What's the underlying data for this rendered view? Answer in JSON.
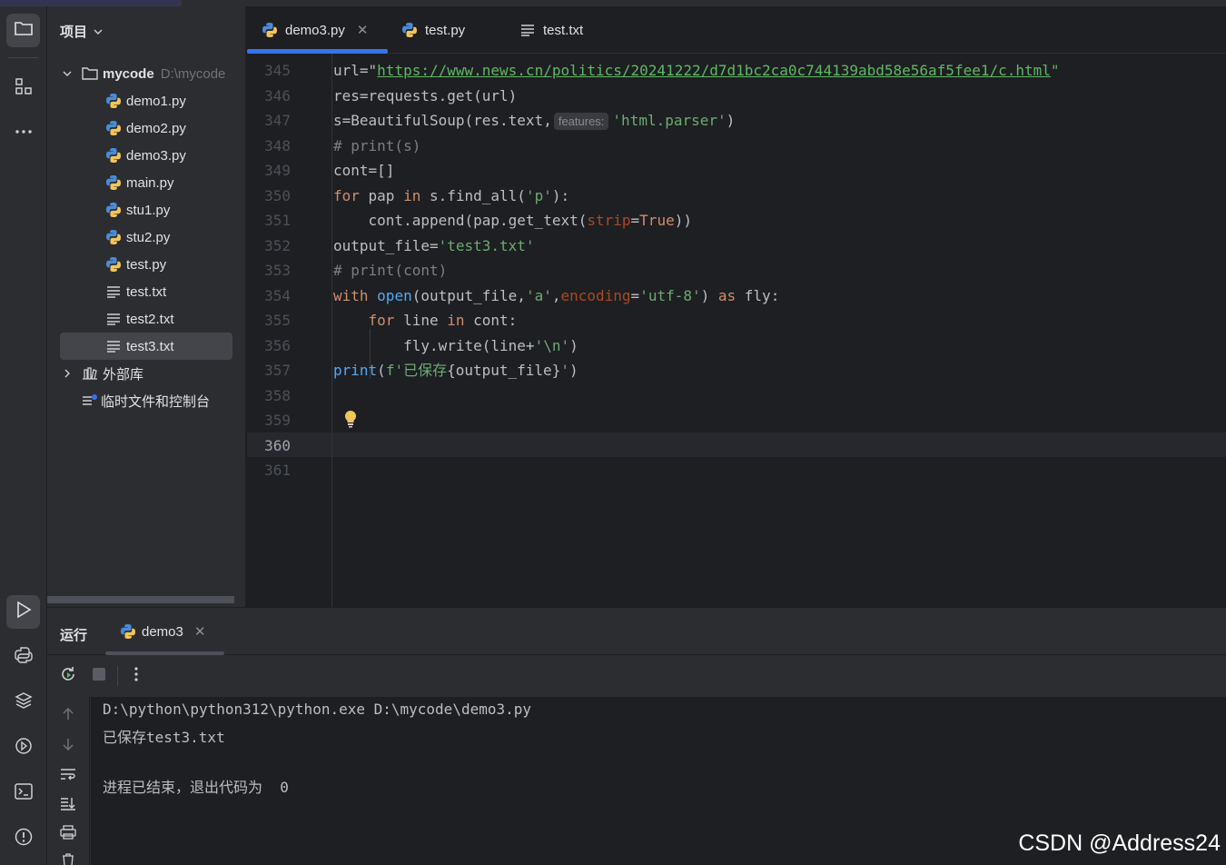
{
  "project": {
    "title": "项目",
    "root": {
      "name": "mycode",
      "path": "D:\\mycode"
    },
    "files": [
      {
        "name": "demo1.py",
        "icon": "python-file-icon"
      },
      {
        "name": "demo2.py",
        "icon": "python-file-icon"
      },
      {
        "name": "demo3.py",
        "icon": "python-file-icon"
      },
      {
        "name": "main.py",
        "icon": "python-file-icon"
      },
      {
        "name": "stu1.py",
        "icon": "python-file-icon"
      },
      {
        "name": "stu2.py",
        "icon": "python-file-icon"
      },
      {
        "name": "test.py",
        "icon": "python-file-icon"
      },
      {
        "name": "test.txt",
        "icon": "text-file-icon"
      },
      {
        "name": "test2.txt",
        "icon": "text-file-icon"
      },
      {
        "name": "test3.txt",
        "icon": "text-file-icon",
        "selected": true
      }
    ],
    "external_libs": "外部库",
    "scratches": "临时文件和控制台"
  },
  "editor": {
    "tabs": [
      {
        "label": "demo3.py",
        "active": true,
        "icon": "python-file-icon"
      },
      {
        "label": "test.py",
        "icon": "python-file-icon"
      },
      {
        "label": "test.txt",
        "icon": "text-file-icon"
      }
    ],
    "line_numbers": [
      "345",
      "346",
      "347",
      "348",
      "349",
      "350",
      "351",
      "352",
      "353",
      "354",
      "355",
      "356",
      "357",
      "358",
      "359",
      "360",
      "361"
    ],
    "current_line": "360",
    "code": {
      "l345_a": "url=\"",
      "l345_url": "https://www.news.cn/politics/20241222/d7d1bc2ca0c744139abd58e56af5fee1/c.html",
      "l345_b": "\"",
      "l346": "res=requests.get(url)",
      "l347_a": "s=BeautifulSoup(res.text,",
      "l347_hint": "features:",
      "l347_str": "'html.parser'",
      "l347_b": ")",
      "l348": "# print(s)",
      "l349": "cont=[]",
      "l350_kw1": "for",
      "l350_a": " pap ",
      "l350_kw2": "in",
      "l350_b": " s.find_all(",
      "l350_str": "'p'",
      "l350_c": "):",
      "l351_a": "    cont.append(pap.get_text(",
      "l351_named": "strip",
      "l351_b": "=",
      "l351_kw": "True",
      "l351_c": "))",
      "l352_a": "output_file=",
      "l352_str": "'test3.txt'",
      "l353": "# print(cont)",
      "l354_kw": "with",
      "l354_fn": "open",
      "l354_a": "(output_file,",
      "l354_str1": "'a'",
      "l354_b": ",",
      "l354_named": "encoding",
      "l354_c": "=",
      "l354_str2": "'utf-8'",
      "l354_d": ") ",
      "l354_kw2": "as",
      "l354_e": " fly:",
      "l355_kw1": "for",
      "l355_a": " line ",
      "l355_kw2": "in",
      "l355_b": " cont:",
      "l356_a": "fly.write(line+",
      "l356_str": "'\\n'",
      "l356_b": ")",
      "l357_fn": "print",
      "l357_a": "(",
      "l357_str1": "f'已保存",
      "l357_b": "{output_file}",
      "l357_str2": "'",
      "l357_c": ")"
    }
  },
  "run": {
    "title": "运行",
    "tab": "demo3",
    "output": [
      "D:\\python\\python312\\python.exe D:\\mycode\\demo3.py",
      "已保存test3.txt",
      "",
      "进程已结束，退出代码为  0"
    ]
  },
  "watermark": "CSDN @Address24"
}
